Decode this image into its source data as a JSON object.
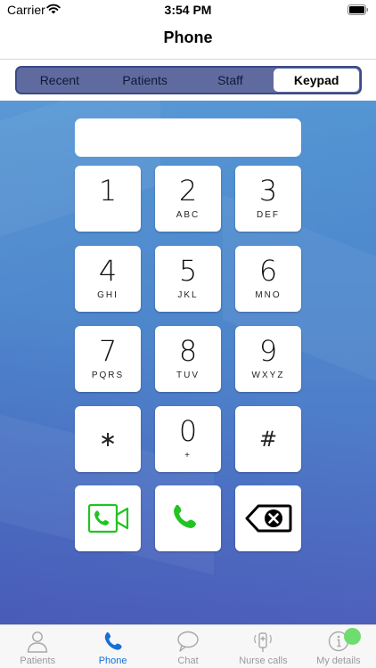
{
  "status_bar": {
    "carrier": "Carrier",
    "time": "3:54 PM"
  },
  "nav": {
    "title": "Phone"
  },
  "segments": [
    {
      "label": "Recent",
      "selected": false
    },
    {
      "label": "Patients",
      "selected": false
    },
    {
      "label": "Staff",
      "selected": false
    },
    {
      "label": "Keypad",
      "selected": true
    }
  ],
  "dial": {
    "value": ""
  },
  "keys": [
    {
      "digit": "1",
      "letters": ""
    },
    {
      "digit": "2",
      "letters": "ABC"
    },
    {
      "digit": "3",
      "letters": "DEF"
    },
    {
      "digit": "4",
      "letters": "GHI"
    },
    {
      "digit": "5",
      "letters": "JKL"
    },
    {
      "digit": "6",
      "letters": "MNO"
    },
    {
      "digit": "7",
      "letters": "PQRS"
    },
    {
      "digit": "8",
      "letters": "TUV"
    },
    {
      "digit": "9",
      "letters": "WXYZ"
    },
    {
      "digit": "∗",
      "letters": ""
    },
    {
      "digit": "0",
      "letters": "+"
    },
    {
      "digit": "#",
      "letters": ""
    }
  ],
  "action_keys": {
    "video_icon": "video-call-icon",
    "call_icon": "phone-call-icon",
    "backspace_icon": "backspace-icon"
  },
  "tabs": [
    {
      "label": "Patients",
      "icon": "person-icon",
      "selected": false
    },
    {
      "label": "Phone",
      "icon": "phone-icon",
      "selected": true
    },
    {
      "label": "Chat",
      "icon": "chat-bubble-icon",
      "selected": false
    },
    {
      "label": "Nurse calls",
      "icon": "nurse-call-icon",
      "selected": false
    },
    {
      "label": "My details",
      "icon": "info-icon",
      "selected": false
    }
  ],
  "colors": {
    "accent": "#1670d6",
    "call_green": "#22c322",
    "segment_bg": "#5f6b9e",
    "keypad_bg_top": "#4f92d2",
    "keypad_bg_bottom": "#5466c0",
    "notify_dot": "#6fdc6f"
  }
}
